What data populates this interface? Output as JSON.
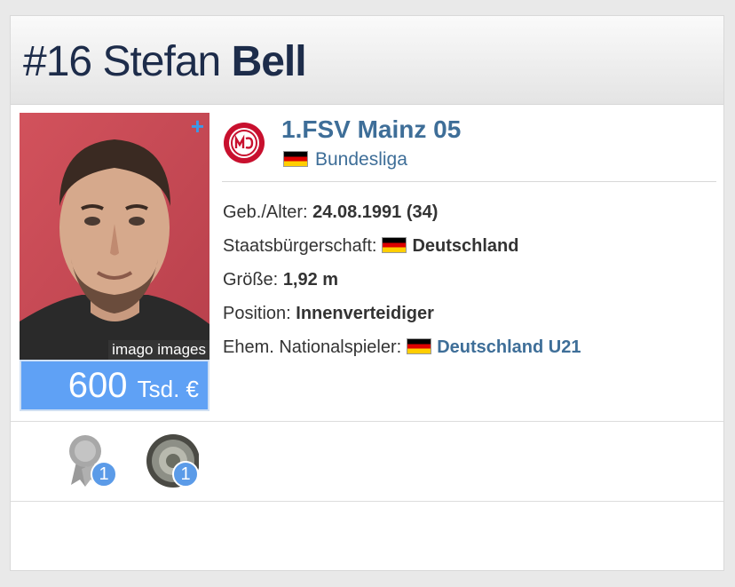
{
  "player": {
    "number": "#16",
    "first_name": "Stefan",
    "last_name": "Bell",
    "photo_credit": "imago images",
    "photo_plus": "+",
    "market_value": {
      "amount": "600",
      "unit": "Tsd. €"
    }
  },
  "club": {
    "name": "1.FSV Mainz 05",
    "league": "Bundesliga"
  },
  "details": {
    "birth_label": "Geb./Alter:",
    "birth_value": "24.08.1991 (34)",
    "citizenship_label": "Staatsbürgerschaft:",
    "citizenship_value": "Deutschland",
    "height_label": "Größe:",
    "height_value": "1,92 m",
    "position_label": "Position:",
    "position_value": "Innenverteidiger",
    "national_label": "Ehem. Nationalspieler:",
    "national_value": "Deutschland U21"
  },
  "awards": [
    {
      "icon": "rosette-award-icon",
      "count": "1"
    },
    {
      "icon": "champion-plate-icon",
      "count": "1"
    }
  ],
  "colors": {
    "title": "#1d2c4a",
    "link": "#3e6e98",
    "value_bg": "#5fa1f5",
    "badge": "#5b9be8",
    "club_red": "#c8102e"
  }
}
